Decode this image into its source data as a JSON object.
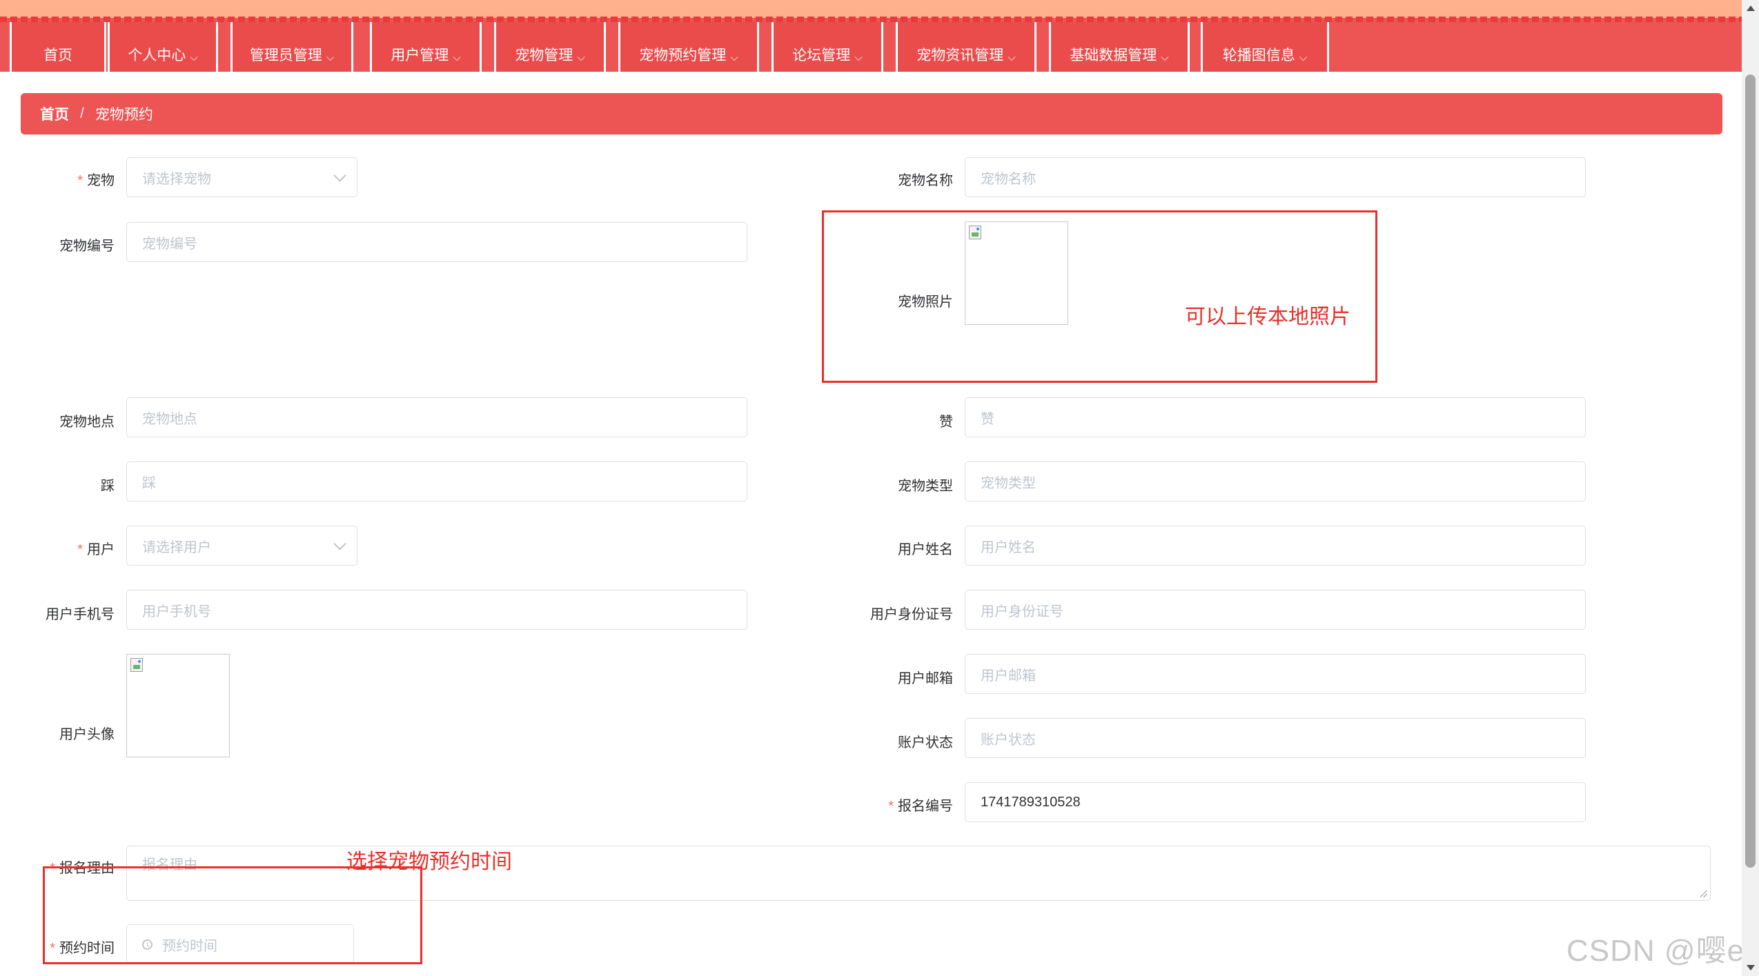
{
  "nav": {
    "items": [
      {
        "label": "首页",
        "dropdown": false
      },
      {
        "label": "个人中心",
        "dropdown": true
      },
      {
        "label": "管理员管理",
        "dropdown": true
      },
      {
        "label": "用户管理",
        "dropdown": true
      },
      {
        "label": "宠物管理",
        "dropdown": true
      },
      {
        "label": "宠物预约管理",
        "dropdown": true
      },
      {
        "label": "论坛管理",
        "dropdown": true
      },
      {
        "label": "宠物资讯管理",
        "dropdown": true
      },
      {
        "label": "基础数据管理",
        "dropdown": true
      },
      {
        "label": "轮播图信息",
        "dropdown": true
      }
    ],
    "chevron": "⌵"
  },
  "breadcrumb": {
    "home": "首页",
    "separator": "/",
    "current": "宠物预约"
  },
  "form": {
    "pet": {
      "label": "宠物",
      "placeholder": "请选择宠物"
    },
    "pet_name": {
      "label": "宠物名称",
      "placeholder": "宠物名称"
    },
    "pet_no": {
      "label": "宠物编号",
      "placeholder": "宠物编号"
    },
    "pet_photo": {
      "label": "宠物照片"
    },
    "pet_location": {
      "label": "宠物地点",
      "placeholder": "宠物地点"
    },
    "likes": {
      "label": "赞",
      "placeholder": "赞"
    },
    "dislikes": {
      "label": "踩",
      "placeholder": "踩"
    },
    "pet_type": {
      "label": "宠物类型",
      "placeholder": "宠物类型"
    },
    "user": {
      "label": "用户",
      "placeholder": "请选择用户"
    },
    "user_name": {
      "label": "用户姓名",
      "placeholder": "用户姓名"
    },
    "user_phone": {
      "label": "用户手机号",
      "placeholder": "用户手机号"
    },
    "user_id_card": {
      "label": "用户身份证号",
      "placeholder": "用户身份证号"
    },
    "user_email": {
      "label": "用户邮箱",
      "placeholder": "用户邮箱"
    },
    "user_avatar": {
      "label": "用户头像"
    },
    "account_status": {
      "label": "账户状态",
      "placeholder": "账户状态"
    },
    "signup_no": {
      "label": "报名编号",
      "value": "1741789310528"
    },
    "signup_reason": {
      "label": "报名理由",
      "placeholder": "报名理由"
    },
    "appointment_time": {
      "label": "预约时间",
      "placeholder": "预约时间"
    },
    "required_mark": "*"
  },
  "annotations": {
    "photo_note": "可以上传本地照片",
    "time_note": "选择宠物预约时间"
  },
  "watermark": "CSDN @嘤er",
  "colors": {
    "primary": "#ed5454",
    "nav_top": "#ffb08c",
    "annotation": "#e8302a",
    "required": "#f56c6c"
  }
}
